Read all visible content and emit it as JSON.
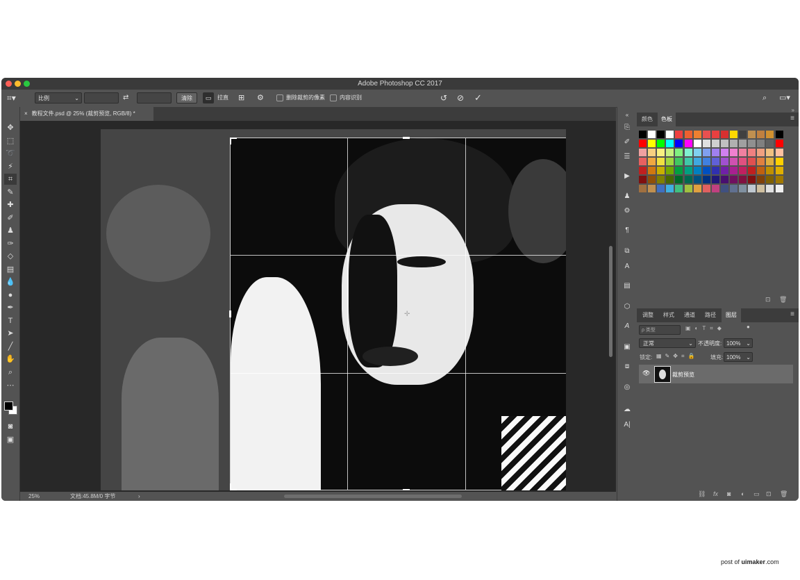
{
  "window": {
    "title": "Adobe Photoshop CC 2017"
  },
  "options": {
    "ratio_label": "比例",
    "clear_label": "清除",
    "straighten_label": "拉直",
    "delete_cropped_label": "删除裁剪的像素",
    "content_aware_label": "内容识别"
  },
  "document": {
    "tab_label": "教程文件.psd @ 25% (裁剪预览, RGB/8) *"
  },
  "status": {
    "zoom": "25%",
    "doc_info": "文档:45.8M/0 字节"
  },
  "panels": {
    "top_tabs": [
      "颜色",
      "色板"
    ],
    "layer_tabs": [
      "调整",
      "样式",
      "通道",
      "路径",
      "图层"
    ],
    "filter_label": "ρ 类型",
    "blend_mode": "正常",
    "opacity_label": "不透明度:",
    "opacity_value": "100%",
    "lock_label": "锁定:",
    "fill_label": "填充:",
    "fill_value": "100%",
    "layer_name": "裁剪预览"
  },
  "swatch_colors": [
    [
      "#000000",
      "#ffffff",
      "#000000",
      "#ffffff",
      "#ee4040",
      "#ee6030",
      "#ee8030",
      "#e85050",
      "#e84040",
      "#d83030",
      "#ffd800",
      "#404040",
      "#c09050",
      "#c08040",
      "#d09030",
      "#000000"
    ],
    [
      "#ff0000",
      "#ffff00",
      "#00ff00",
      "#00ffff",
      "#0000ff",
      "#ff00ff",
      "#ffffff",
      "#e0e0e0",
      "#d0d0d0",
      "#c0c0c0",
      "#b0b0b0",
      "#a0a0a0",
      "#909090",
      "#808080",
      "#606060",
      "#ff0000"
    ],
    [
      "#f0a0a0",
      "#f8d080",
      "#f8f080",
      "#c8f080",
      "#80f080",
      "#80f0d0",
      "#80d0f0",
      "#80a0f0",
      "#a080f0",
      "#d080f0",
      "#f080d0",
      "#f080a0",
      "#f08080",
      "#f0a080",
      "#f0c080",
      "#ffc0a0"
    ],
    [
      "#e86060",
      "#f0a840",
      "#f0e040",
      "#a0d840",
      "#40c860",
      "#40c8a8",
      "#40a8e0",
      "#4080e0",
      "#6060d8",
      "#a050d0",
      "#d050b0",
      "#e05080",
      "#e05050",
      "#e08040",
      "#e0b040",
      "#ffd000"
    ],
    [
      "#c02020",
      "#d07810",
      "#c8b000",
      "#70a800",
      "#00a040",
      "#00a080",
      "#0080c0",
      "#0050c0",
      "#3030b0",
      "#7020a8",
      "#a82090",
      "#c02060",
      "#c02020",
      "#c06010",
      "#c09000",
      "#e0b000"
    ],
    [
      "#801010",
      "#905008",
      "#808000",
      "#486800",
      "#006828",
      "#006850",
      "#005080",
      "#003080",
      "#201878",
      "#480f70",
      "#701060",
      "#801040",
      "#801010",
      "#804008",
      "#806000",
      "#a07800"
    ],
    [
      "#a07040",
      "#c09050",
      "#4070c0",
      "#40b0e0",
      "#40c080",
      "#a0c040",
      "#e0a040",
      "#e06060",
      "#c04080",
      "#405080",
      "#607090",
      "#8090a0",
      "#c0c8d0",
      "#d0c0a0",
      "#e0e0e0",
      "#f0f0f0"
    ]
  ]
}
